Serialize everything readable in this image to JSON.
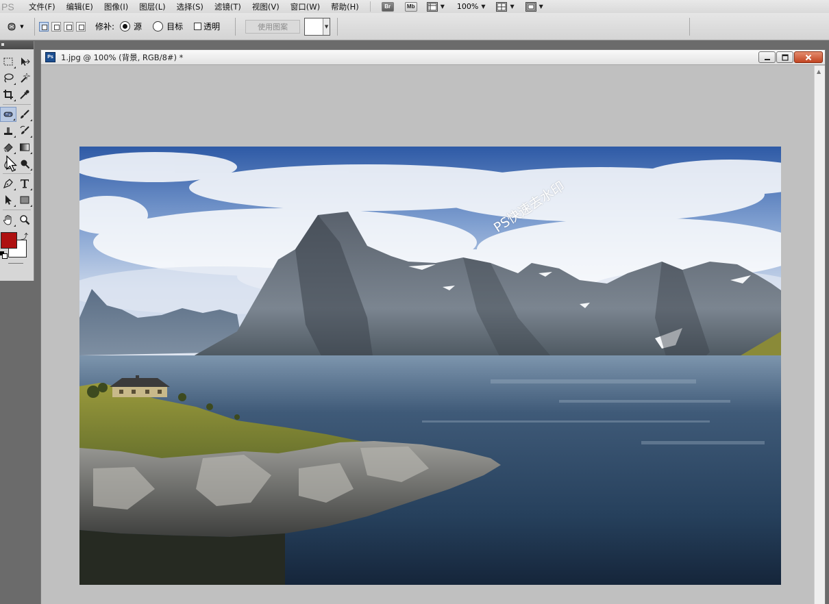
{
  "app": {
    "logo": "PS",
    "menus": [
      "文件(F)",
      "编辑(E)",
      "图像(I)",
      "图层(L)",
      "选择(S)",
      "滤镜(T)",
      "视图(V)",
      "窗口(W)",
      "帮助(H)"
    ],
    "bridge_label": "Br",
    "minibridge_label": "Mb",
    "zoom": "100%"
  },
  "options": {
    "patch_label": "修补:",
    "source_label": "源",
    "destination_label": "目标",
    "transparent_label": "透明",
    "use_pattern_label": "使用图案",
    "patch_mode": "source"
  },
  "tools": {
    "foreground_color": "#ae1010",
    "background_color": "#ffffff",
    "active_tool": "patch-tool"
  },
  "document": {
    "title": "1.jpg @ 100% (背景, RGB/8#) *",
    "ps_icon": "Ps",
    "watermark": "PS快速去水印"
  },
  "icons": {
    "minimize": "minimize-icon",
    "maximize": "maximize-icon",
    "close": "close-icon"
  }
}
